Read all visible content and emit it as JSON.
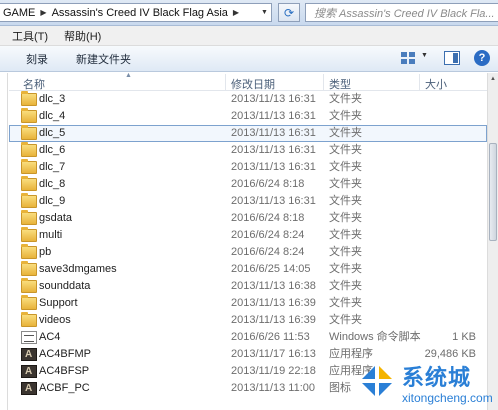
{
  "address": {
    "segments": [
      "GAME",
      "Assassin's Creed IV Black Flag Asia"
    ],
    "search_placeholder": "搜索 Assassin's Creed IV Black Fla..."
  },
  "menu": [
    "工具(T)",
    "帮助(H)"
  ],
  "toolbar": {
    "burn_label": "刻录",
    "new_folder_label": "新建文件夹"
  },
  "columns": {
    "name": "名称",
    "date": "修改日期",
    "type": "类型",
    "size": "大小"
  },
  "files": [
    {
      "name": "dlc_3",
      "date": "2013/11/13 16:31",
      "type": "文件夹",
      "size": "",
      "icon": "folder-icon"
    },
    {
      "name": "dlc_4",
      "date": "2013/11/13 16:31",
      "type": "文件夹",
      "size": "",
      "icon": "folder-icon"
    },
    {
      "name": "dlc_5",
      "date": "2013/11/13 16:31",
      "type": "文件夹",
      "size": "",
      "icon": "folder-icon",
      "selected": true
    },
    {
      "name": "dlc_6",
      "date": "2013/11/13 16:31",
      "type": "文件夹",
      "size": "",
      "icon": "folder-icon"
    },
    {
      "name": "dlc_7",
      "date": "2013/11/13 16:31",
      "type": "文件夹",
      "size": "",
      "icon": "folder-icon"
    },
    {
      "name": "dlc_8",
      "date": "2016/6/24 8:18",
      "type": "文件夹",
      "size": "",
      "icon": "folder-icon"
    },
    {
      "name": "dlc_9",
      "date": "2013/11/13 16:31",
      "type": "文件夹",
      "size": "",
      "icon": "folder-icon"
    },
    {
      "name": "gsdata",
      "date": "2016/6/24 8:18",
      "type": "文件夹",
      "size": "",
      "icon": "folder-icon"
    },
    {
      "name": "multi",
      "date": "2016/6/24 8:24",
      "type": "文件夹",
      "size": "",
      "icon": "folder-icon"
    },
    {
      "name": "pb",
      "date": "2016/6/24 8:24",
      "type": "文件夹",
      "size": "",
      "icon": "folder-icon"
    },
    {
      "name": "save3dmgames",
      "date": "2016/6/25 14:05",
      "type": "文件夹",
      "size": "",
      "icon": "folder-icon"
    },
    {
      "name": "sounddata",
      "date": "2013/11/13 16:38",
      "type": "文件夹",
      "size": "",
      "icon": "folder-icon"
    },
    {
      "name": "Support",
      "date": "2013/11/13 16:39",
      "type": "文件夹",
      "size": "",
      "icon": "folder-icon"
    },
    {
      "name": "videos",
      "date": "2013/11/13 16:39",
      "type": "文件夹",
      "size": "",
      "icon": "folder-icon"
    },
    {
      "name": "AC4",
      "date": "2016/6/26 11:53",
      "type": "Windows 命令脚本",
      "size": "1 KB",
      "icon": "script-icon"
    },
    {
      "name": "AC4BFMP",
      "date": "2013/11/17 16:13",
      "type": "应用程序",
      "size": "29,486 KB",
      "icon": "app-icon"
    },
    {
      "name": "AC4BFSP",
      "date": "2013/11/19 22:18",
      "type": "应用程序",
      "size": "",
      "icon": "app-icon"
    },
    {
      "name": "ACBF_PC",
      "date": "2013/11/13 11:00",
      "type": "图标",
      "size": "",
      "icon": "app-icon"
    }
  ],
  "watermark": {
    "title": "系统城",
    "url": "xitongcheng.com"
  },
  "colors": {
    "selection_border": "#7da2ce",
    "selection_fill": "#f2f7fd",
    "brand_blue": "#2a7fd6"
  }
}
